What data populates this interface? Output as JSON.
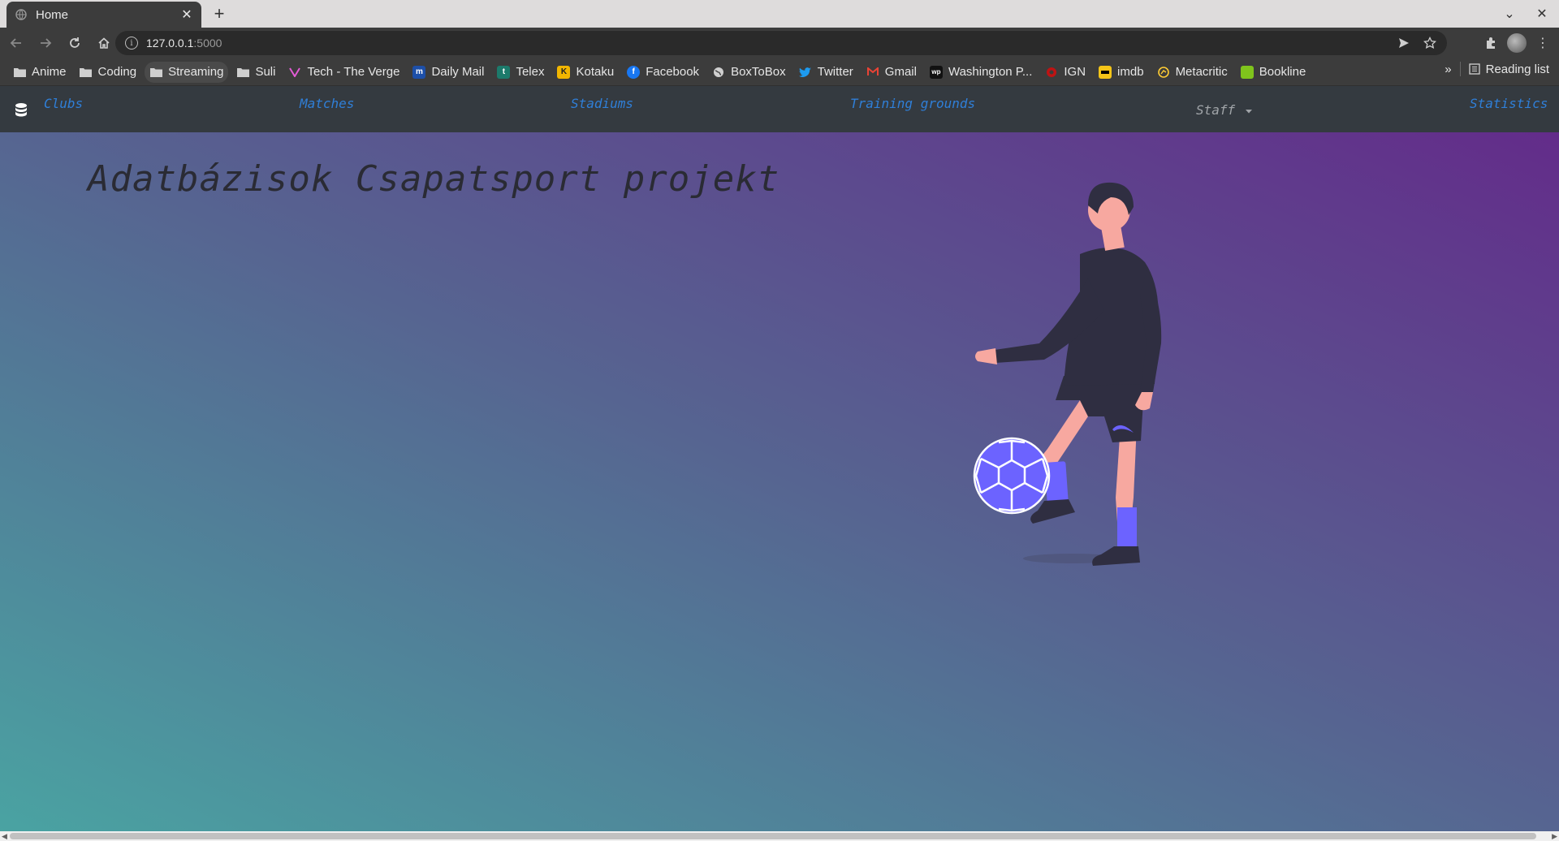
{
  "browser": {
    "tab_title": "Home",
    "address_host": "127.0.0.1",
    "address_port": ":5000",
    "reading_list": "Reading list",
    "overflow": "»",
    "bookmarks": [
      {
        "label": "Anime",
        "icon": "folder-icon"
      },
      {
        "label": "Coding",
        "icon": "folder-icon"
      },
      {
        "label": "Streaming",
        "icon": "folder-icon"
      },
      {
        "label": "Suli",
        "icon": "folder-icon"
      },
      {
        "label": "Tech - The Verge",
        "icon": "verge-icon"
      },
      {
        "label": "Daily Mail",
        "icon": "dailymail-icon"
      },
      {
        "label": "Telex",
        "icon": "telex-icon"
      },
      {
        "label": "Kotaku",
        "icon": "kotaku-icon"
      },
      {
        "label": "Facebook",
        "icon": "facebook-icon"
      },
      {
        "label": "BoxToBox",
        "icon": "globe-icon"
      },
      {
        "label": "Twitter",
        "icon": "twitter-icon"
      },
      {
        "label": "Gmail",
        "icon": "gmail-icon"
      },
      {
        "label": "Washington P...",
        "icon": "washingtonpost-icon"
      },
      {
        "label": "IGN",
        "icon": "ign-icon"
      },
      {
        "label": "imdb",
        "icon": "imdb-icon"
      },
      {
        "label": "Metacritic",
        "icon": "metacritic-icon"
      },
      {
        "label": "Bookline",
        "icon": "bookline-icon"
      }
    ]
  },
  "navbar": {
    "clubs": "Clubs",
    "matches": "Matches",
    "stadiums": "Stadiums",
    "training_grounds": "Training grounds",
    "staff": "Staff",
    "statistics": "Statistics"
  },
  "hero": {
    "title": "Adatbázisok Csapatsport projekt"
  },
  "colors": {
    "navbar_bg": "#343a40",
    "link": "#2f7fd8",
    "gradient_start": "#4aa3a2",
    "gradient_mid": "#566591",
    "gradient_end": "#632c8a",
    "accent_purple": "#6c63ff"
  }
}
